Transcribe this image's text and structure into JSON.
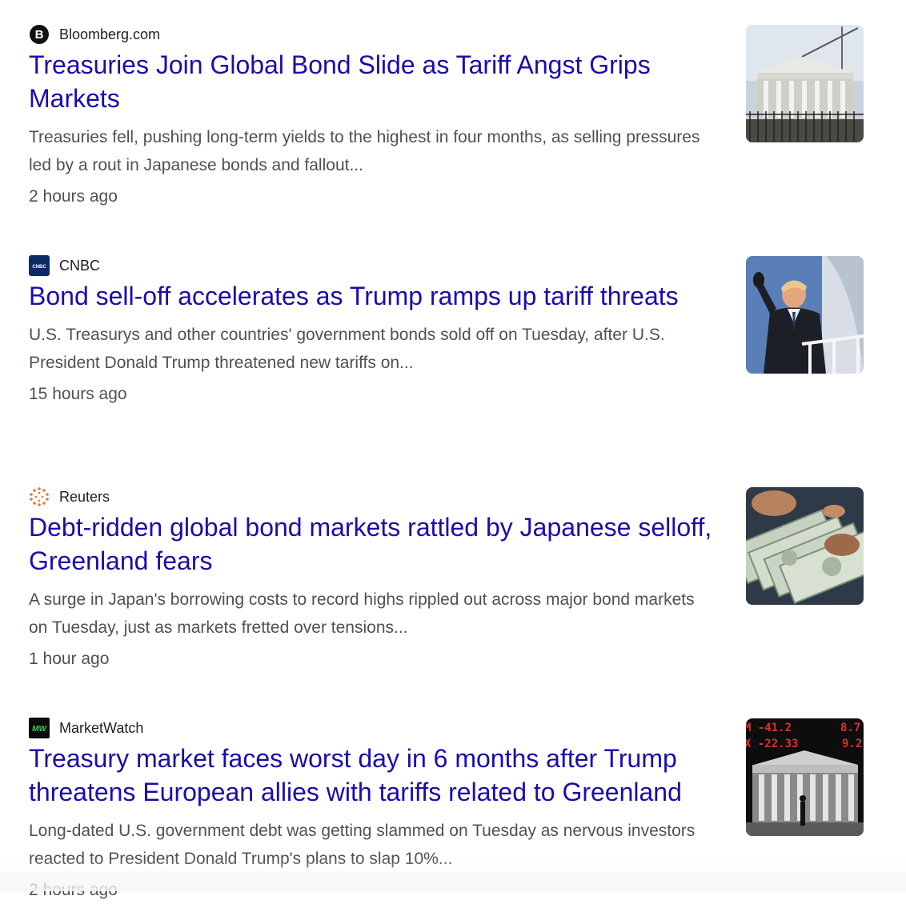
{
  "articles": [
    {
      "source": "Bloomberg.com",
      "source_icon": "bloomberg-icon",
      "headline": "Treasuries Join Global Bond Slide as Tariff Angst Grips Markets",
      "snippet": "Treasuries fell, pushing long-term yields to the highest in four months, as selling pressures led by a rout in Japanese bonds and fallout...",
      "age": "2 hours ago",
      "thumbnail": "treasury-building-thumbnail"
    },
    {
      "source": "CNBC",
      "source_icon": "cnbc-icon",
      "headline": "Bond sell-off accelerates as Trump ramps up tariff threats",
      "snippet": "U.S. Treasurys and other countries' government bonds sold off on Tuesday, after U.S. President Donald Trump threatened new tariffs on...",
      "age": "15 hours ago",
      "thumbnail": "trump-waving-thumbnail"
    },
    {
      "source": "Reuters",
      "source_icon": "reuters-icon",
      "headline": "Debt-ridden global bond markets rattled by Japanese selloff, Greenland fears",
      "snippet": "A surge in Japan's borrowing costs to record highs rippled out across major bond markets on Tuesday, just as markets fretted over tensions...",
      "age": "1 hour ago",
      "thumbnail": "dollar-bills-thumbnail"
    },
    {
      "source": "MarketWatch",
      "source_icon": "marketwatch-icon",
      "headline": "Treasury market faces worst day in 6 months after Trump threatens European allies with tariffs related to Greenland",
      "snippet": "Long-dated U.S. government debt was getting slammed on Tuesday as nervous investors reacted to President Donald Trump's plans to slap 10%...",
      "age": "2 hours ago",
      "thumbnail": "stock-ticker-treasury-thumbnail"
    }
  ],
  "logos": {
    "bloomberg_letter": "B",
    "cnbc_text": "CNBC",
    "marketwatch_text": "MW"
  },
  "thumb_text": {
    "ticker_1": "M -41.2",
    "ticker_2": "X -22.33",
    "ticker_3": "9.2",
    "ticker_4": "8.7"
  },
  "colors": {
    "headline_link": "#1a0dab",
    "snippet_text": "#4d5156",
    "source_text": "#202124",
    "cnbc_bg": "#0a2b66",
    "reuters_orange": "#e8773a",
    "marketwatch_green": "#39d353"
  }
}
